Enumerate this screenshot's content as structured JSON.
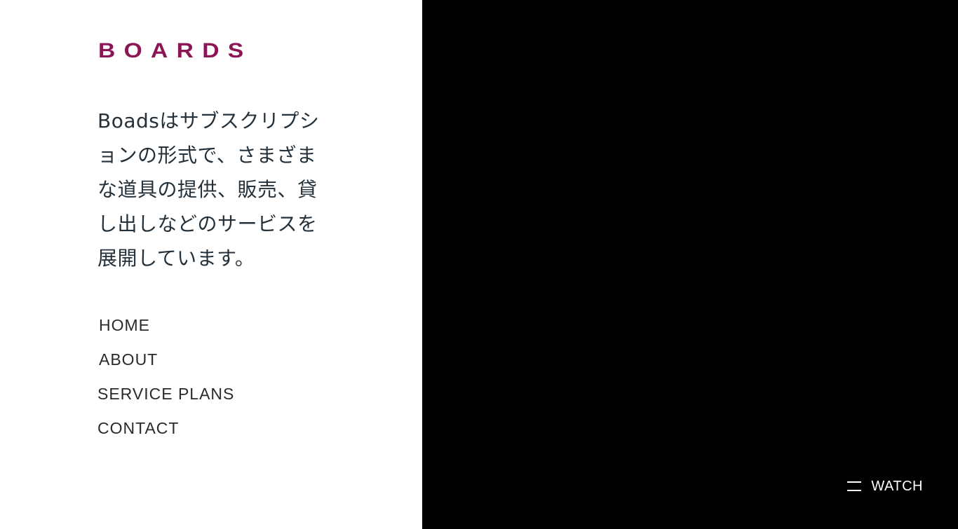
{
  "brand": {
    "logo_text": "BOARDS",
    "logo_color": "#8b1654"
  },
  "intro": {
    "tagline": "Boadsはサブスクリプションの形式で、さまざまな道具の提供、販売、貸し出しなどのサービスを展開しています。"
  },
  "nav": {
    "items": [
      {
        "label": "HOME"
      },
      {
        "label": "ABOUT"
      },
      {
        "label": "SERVICE PLANS"
      },
      {
        "label": "CONTACT"
      }
    ]
  },
  "media": {
    "background_color": "#000000",
    "watch_label": "WATCH",
    "watch_icon": "menu-lines-icon"
  }
}
